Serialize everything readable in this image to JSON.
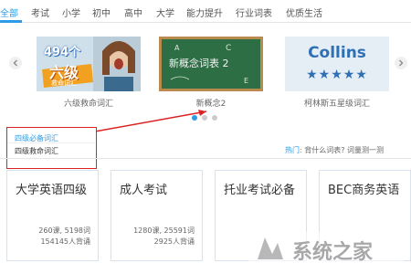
{
  "tabs": [
    "全部",
    "考试",
    "小学",
    "初中",
    "高中",
    "大学",
    "能力提升",
    "行业词表",
    "优质生活"
  ],
  "carousel": {
    "cards": [
      {
        "cover_top": "494个",
        "cover_main": "六级",
        "cover_sub": "救命词汇",
        "caption": "六级救命词汇"
      },
      {
        "cover_main": "新概念词表 2",
        "caption": "新概念2"
      },
      {
        "cover_main": "Collins",
        "cover_stars": "★★★★★",
        "caption": "柯林斯五星级词汇"
      }
    ]
  },
  "popup": {
    "title": "四级必备词汇",
    "subtitle": "四级救命词汇"
  },
  "hot": {
    "label": "热门:",
    "link1": "背什么词表?",
    "link2": "词量测一测"
  },
  "books": [
    {
      "title": "大学英语四级",
      "stats": "260课, 5198词",
      "learners": "154145人背诵"
    },
    {
      "title": "成人考试",
      "stats": "1280课, 25591词",
      "learners": "2925人背诵"
    },
    {
      "title": "托业考试必备",
      "stats": "",
      "learners": ""
    },
    {
      "title": "BEC商务英语",
      "stats": "",
      "learners": ""
    }
  ],
  "watermark": {
    "text": "系统之家"
  },
  "colors": {
    "accent": "#2e9be6",
    "highlight": "#dd2222",
    "chalkboard": "#2d6e45"
  }
}
